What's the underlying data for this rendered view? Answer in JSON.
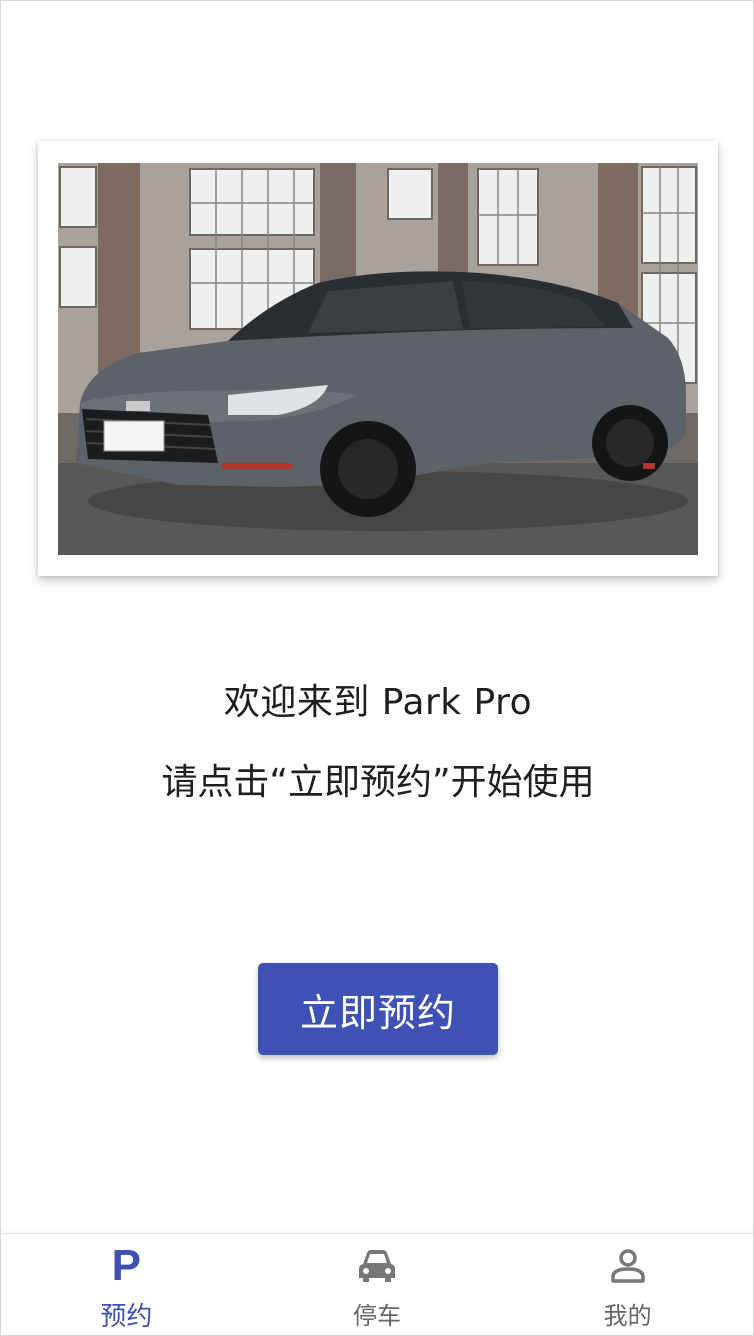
{
  "welcome": {
    "line1": "欢迎来到 Park Pro",
    "line2": "请点击“立即预约”开始使用"
  },
  "actions": {
    "reserve_label": "立即预约"
  },
  "tabs": [
    {
      "label": "预约",
      "icon": "parking-icon",
      "active": true
    },
    {
      "label": "停车",
      "icon": "car-icon",
      "active": false
    },
    {
      "label": "我的",
      "icon": "person-icon",
      "active": false
    }
  ],
  "colors": {
    "accent": "#3f51b5",
    "tab_inactive": "#666666"
  }
}
